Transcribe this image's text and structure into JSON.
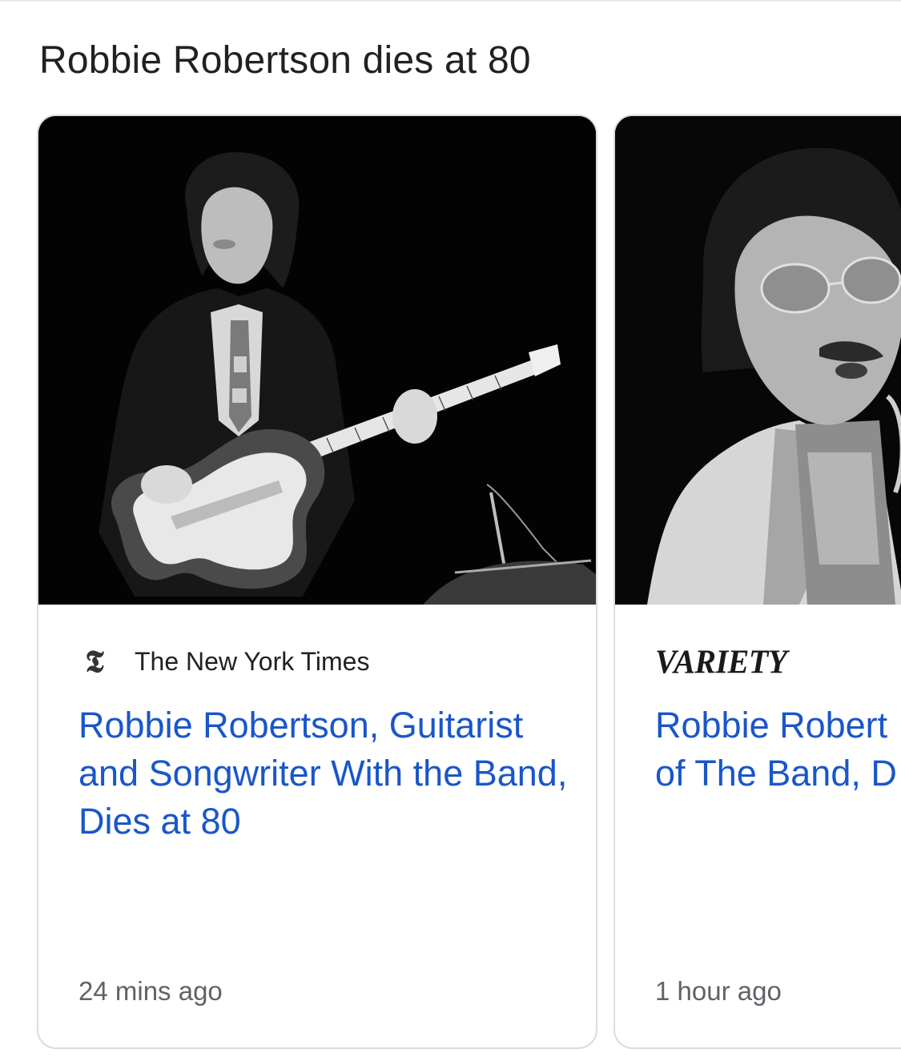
{
  "section": {
    "title": "Robbie Robertson dies at 80"
  },
  "cards": [
    {
      "source": "The New York Times",
      "source_logo_glyph": "𝕿",
      "source_icon": "nyt-t-icon",
      "headline": "Robbie Robertson, Guitarist and Songwriter With the Band, Dies at 80",
      "time": "24 mins ago",
      "image_alt": "black-and-white photo of a guitarist on stage"
    },
    {
      "source_logo_text": "VARIETY",
      "source_icon": "variety-logo",
      "headline_line1": "Robbie Robert",
      "headline_line2": "of The Band, D",
      "time": "1 hour ago",
      "image_alt": "black-and-white photo of a singer with tinted glasses"
    }
  ],
  "colors": {
    "headline": "#1a56c8",
    "title": "#202124",
    "meta": "#5f6368",
    "card_border": "#dadce0"
  }
}
